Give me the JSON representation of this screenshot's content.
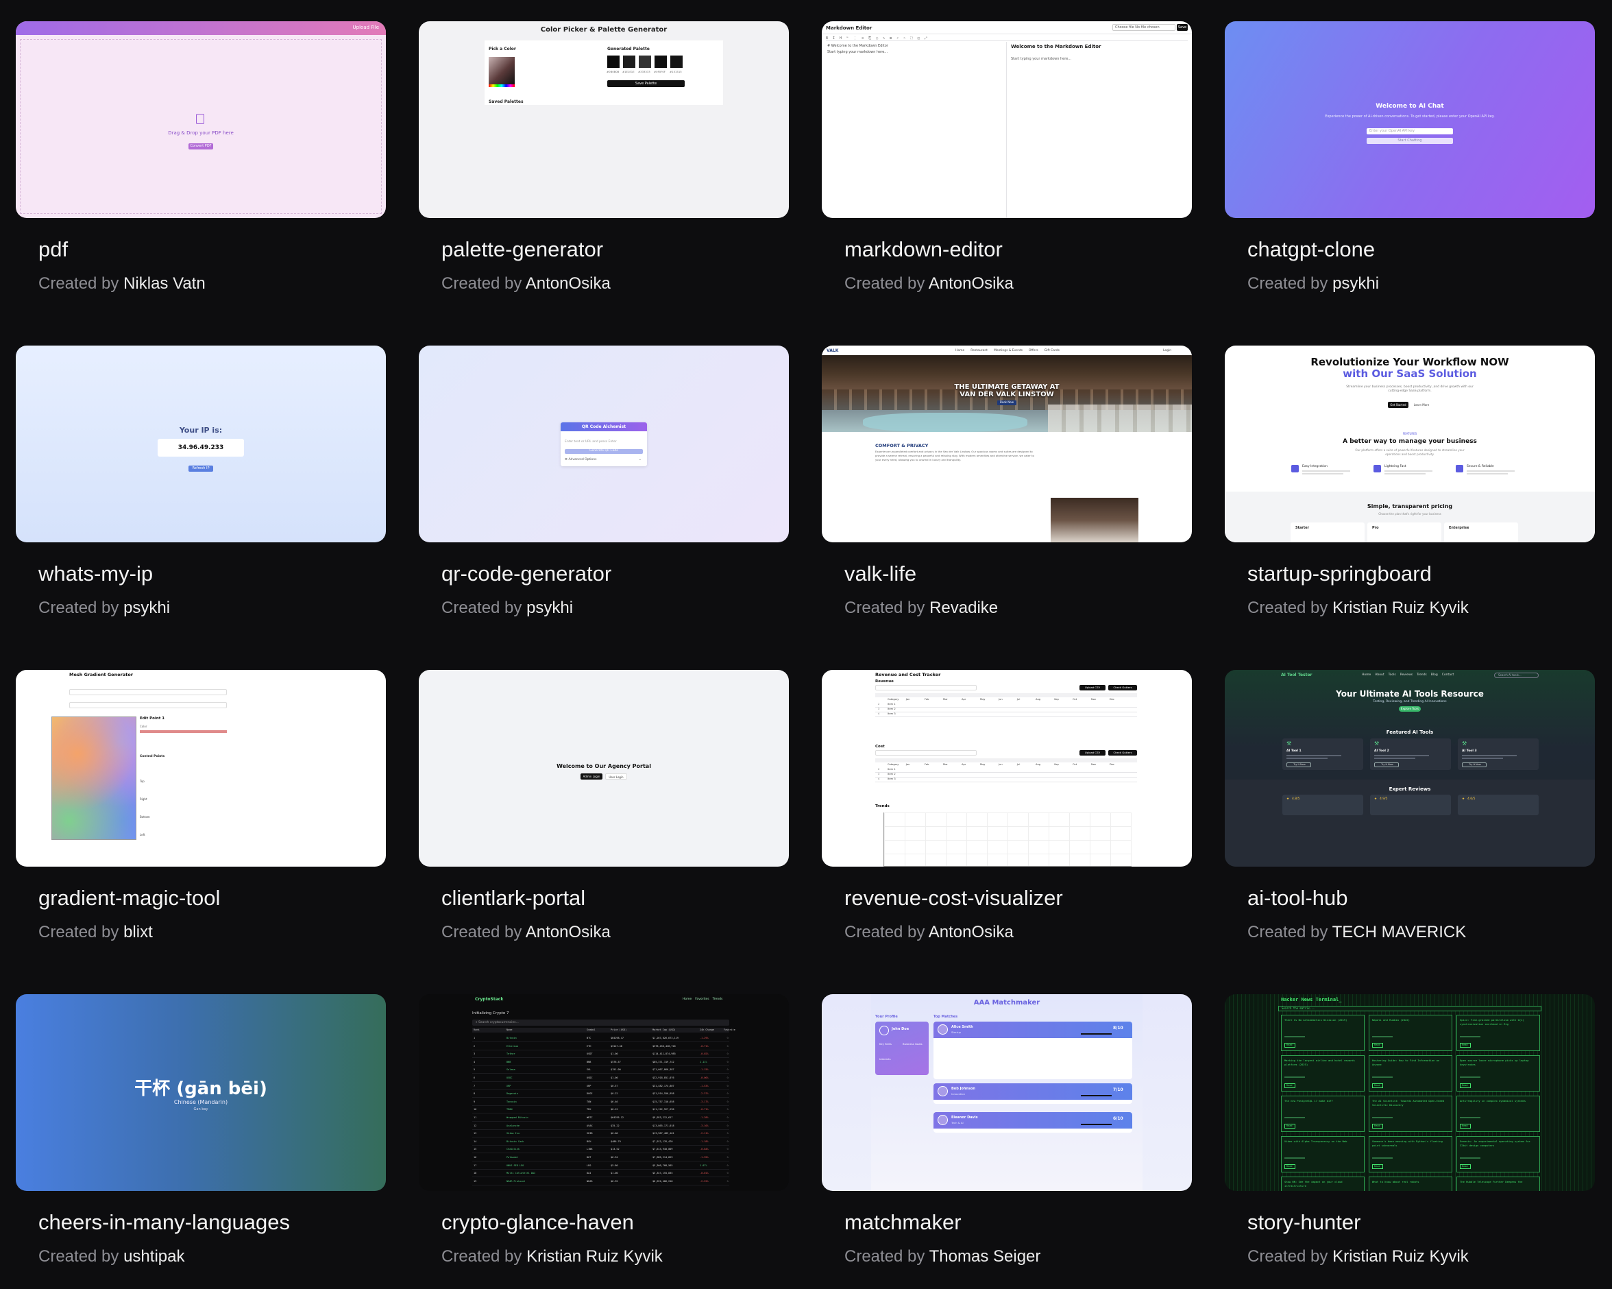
{
  "created_by_prefix": "Created by",
  "projects": [
    {
      "title": "pdf",
      "author": "Niklas Vatn",
      "thumb": {
        "header_button": "Upload File",
        "drop_text": "Drag & Drop your PDF here",
        "button": "Convert PDF"
      }
    },
    {
      "title": "palette-generator",
      "author": "AntonOsika",
      "thumb": {
        "heading": "Color Picker & Palette Generator",
        "pick_label": "Pick a Color",
        "generated_label": "Generated Palette",
        "saved_label": "Saved Palettes",
        "save_button": "Save Palette",
        "swatches": [
          "#0b0b0b",
          "#1e1e1e",
          "#333333",
          "#0f0f0f",
          "#151515"
        ],
        "swatch_codes": [
          "#0B0B0B",
          "#1E1E1E",
          "#333333",
          "#0F0F0F",
          "#151515"
        ]
      }
    },
    {
      "title": "markdown-editor",
      "author": "AntonOsika",
      "thumb": {
        "heading": "Markdown Editor",
        "file_placeholder": "Choose file  No file chosen",
        "file_button": "Save",
        "left_line1": "# Welcome to the Markdown Editor",
        "left_line2": "Start typing your markdown here...",
        "preview_title": "Welcome to the Markdown Editor",
        "preview_text": "Start typing your markdown here..."
      }
    },
    {
      "title": "chatgpt-clone",
      "author": "psykhi",
      "thumb": {
        "heading": "Welcome to AI Chat",
        "subtitle": "Experience the power of AI-driven conversations. To get started, please enter your OpenAI API key.",
        "input_placeholder": "Enter your OpenAI API key",
        "button": "Start Chatting"
      }
    },
    {
      "title": "whats-my-ip",
      "author": "psykhi",
      "thumb": {
        "label": "Your IP is:",
        "ip": "34.96.49.233",
        "button": "Refresh IP"
      }
    },
    {
      "title": "qr-code-generator",
      "author": "psykhi",
      "thumb": {
        "header": "QR Code Alchemist",
        "input_placeholder": "Enter text or URL and press Enter",
        "button": "Generate QR Code",
        "advanced": "Advanced Options"
      }
    },
    {
      "title": "valk-life",
      "author": "Revadike",
      "thumb": {
        "brand": "VALK",
        "nav": [
          "Home",
          "Restaurant",
          "Meetings & Events",
          "Offers",
          "Gift Cards"
        ],
        "login": "Login",
        "hero_line1": "THE ULTIMATE GETAWAY AT",
        "hero_line2": "VAN DER VALK LINSTOW",
        "hero_button": "Book Now",
        "section_title": "COMFORT & PRIVACY",
        "section_text": "Experience unparalleled comfort and privacy in the Van der Valk Linstow. Our spacious rooms and suites are designed to provide a serene retreat, ensuring a peaceful and relaxing stay. With modern amenities and attentive service, we cater to your every need, allowing you to unwind in luxury and tranquility."
      }
    },
    {
      "title": "startup-springboard",
      "author": "Kristian Ruiz Kyvik",
      "thumb": {
        "hero_line1": "Revolutionize Your Workflow NOW",
        "hero_line2": "with Our SaaS Solution",
        "hero_sub": "Streamline your business processes, boost productivity, and drive growth with our cutting-edge SaaS platform.",
        "btn_primary": "Get Started",
        "btn_secondary": "Learn More",
        "features_label": "FEATURES",
        "features_title": "A better way to manage your business",
        "features_sub": "Our platform offers a suite of powerful features designed to streamline your operations and boost productivity.",
        "features": [
          "Easy Integration",
          "Lightning Fast",
          "Secure & Reliable"
        ],
        "pricing_title": "Simple, transparent pricing",
        "pricing_sub": "Choose the plan that's right for your business",
        "plans": [
          "Starter",
          "Pro",
          "Enterprise"
        ]
      }
    },
    {
      "title": "gradient-magic-tool",
      "author": "blixt",
      "thumb": {
        "heading": "Mesh Gradient Generator",
        "edit_label": "Edit Point 1",
        "color_label": "Color",
        "control_label": "Control Points",
        "labels": [
          "Top",
          "Right",
          "Bottom",
          "Left"
        ]
      }
    },
    {
      "title": "clientlark-portal",
      "author": "AntonOsika",
      "thumb": {
        "heading": "Welcome to Our Agency Portal",
        "btn_admin": "Admin Login",
        "btn_user": "User Login"
      }
    },
    {
      "title": "revenue-cost-visualizer",
      "author": "AntonOsika",
      "thumb": {
        "heading": "Revenue and Cost Tracker",
        "revenue_label": "Revenue",
        "cost_label": "Cost",
        "trends_label": "Trends",
        "upload": "Upload CSV",
        "check": "Check Gutters",
        "months": [
          "Category",
          "Jan",
          "Feb",
          "Mar",
          "Apr",
          "May",
          "Jun",
          "Jul",
          "Aug",
          "Sep",
          "Oct",
          "Nov",
          "Dec"
        ],
        "items": [
          "Item 1",
          "Item 2",
          "Item 3"
        ]
      }
    },
    {
      "title": "ai-tool-hub",
      "author": "TECH MAVERICK",
      "thumb": {
        "brand": "AI Tool Tester",
        "nav": [
          "Home",
          "About",
          "Tools",
          "Reviews",
          "Trends",
          "Blog",
          "Contact"
        ],
        "search_placeholder": "Search AI tools...",
        "hero_title": "Your Ultimate AI Tools Resource",
        "hero_sub": "Testing, Reviewing, and Trending AI Innovations",
        "hero_button": "Explore Tools",
        "featured_title": "Featured AI Tools",
        "tools": [
          "AI Tool 1",
          "AI Tool 2",
          "AI Tool 3"
        ],
        "tool_button": "Try It Now",
        "reviews_title": "Expert Reviews",
        "ratings": [
          "4.8/5",
          "4.9/5",
          "4.6/5"
        ]
      }
    },
    {
      "title": "cheers-in-many-languages",
      "author": "ushtipak",
      "thumb": {
        "phrase": "干杯 (gān bēi)",
        "language": "Chinese (Mandarin)",
        "pronunciation": "Gan bay"
      }
    },
    {
      "title": "crypto-glance-haven",
      "author": "Kristian Ruiz Kyvik",
      "thumb": {
        "brand": "CryptoStack",
        "nav": [
          "Home",
          "Favorites",
          "Trends"
        ],
        "status": "Initializing Crypto 7",
        "search_placeholder": "Search cryptocurrencies...",
        "columns": [
          "Rank",
          "Name",
          "Symbol",
          "Price (USD)",
          "Market Cap (USD)",
          "24h Change",
          "Favorite"
        ],
        "rows": [
          [
            "1",
            "Bitcoin",
            "BTC",
            "$64298.47",
            "$1,267,826,673,119",
            "-1.29%"
          ],
          [
            "2",
            "Ethereum",
            "ETH",
            "$3147.48",
            "$378,456,428,726",
            "-0.71%"
          ],
          [
            "3",
            "Tether",
            "USDT",
            "$1.00",
            "$114,411,874,985",
            "-0.02%"
          ],
          [
            "4",
            "BNB",
            "BNB",
            "$578.57",
            "$85,371,319,742",
            "1.11%"
          ],
          [
            "5",
            "Solana",
            "SOL",
            "$151.00",
            "$71,667,860,387",
            "-1.15%"
          ],
          [
            "6",
            "USDC",
            "USDC",
            "$1.00",
            "$32,918,851,076",
            "-0.00%"
          ],
          [
            "7",
            "XRP",
            "XRP",
            "$0.57",
            "$31,482,174,807",
            "-1.53%"
          ],
          [
            "8",
            "Dogecoin",
            "DOGE",
            "$0.22",
            "$31,914,550,958",
            "-2.37%"
          ],
          [
            "9",
            "Toncoin",
            "TON",
            "$6.46",
            "$15,757,310,658",
            "-3.17%"
          ],
          [
            "10",
            "TRON",
            "TRX",
            "$0.12",
            "$11,122,927,290",
            "-0.71%"
          ],
          [
            "11",
            "Wrapped Bitcoin",
            "WBTC",
            "$64295.12",
            "$9,953,212,617",
            "-1.28%"
          ],
          [
            "12",
            "Avalanche",
            "AVAX",
            "$35.22",
            "$13,865,171,018",
            "-3.10%"
          ],
          [
            "13",
            "Shiba Inu",
            "SHIB",
            "$0.00",
            "$13,967,485,101",
            "-2.11%"
          ],
          [
            "14",
            "Bitcoin Cash",
            "BCH",
            "$486.79",
            "$7,912,176,470",
            "-1.18%"
          ],
          [
            "15",
            "Chainlink",
            "LINK",
            "$13.52",
            "$7,613,940,009",
            "-0.84%"
          ],
          [
            "16",
            "Polkadot",
            "DOT",
            "$6.94",
            "$7,985,214,829",
            "-1.35%"
          ],
          [
            "17",
            "UNUS SED LEO",
            "LEO",
            "$5.80",
            "$5,366,708,565",
            "1.07%"
          ],
          [
            "18",
            "Multi Collateral DAI",
            "DAI",
            "$1.00",
            "$5,347,155,835",
            "-0.01%"
          ],
          [
            "19",
            "NEAR Protocol",
            "NEAR",
            "$6.35",
            "$6,922,486,218",
            "-2.22%"
          ]
        ]
      }
    },
    {
      "title": "matchmaker",
      "author": "Thomas Seiger",
      "thumb": {
        "heading": "AAA Matchmaker",
        "profile_label": "Your Profile",
        "matches_label": "Top Matches",
        "profile_name": "John Doe",
        "key_skills": "Key Skills",
        "business_goals": "Business Goals",
        "interests": "Interests",
        "matches": [
          {
            "name": "Alice Smith",
            "role": "Startup",
            "score": "8/10"
          },
          {
            "name": "Bob Johnson",
            "role": "Innovation",
            "score": "7/10"
          },
          {
            "name": "Eleanor Davis",
            "role": "Tech & AI",
            "score": "6/10"
          }
        ]
      }
    },
    {
      "title": "story-hunter",
      "author": "Kristian Ruiz Kyvik",
      "thumb": {
        "heading": "Hacker News Terminal_",
        "search_placeholder": "Search the matrix...",
        "read": "Read",
        "stories": [
          "There Is No Antimemetics Division (2019)",
          "Napoli and Rumbia (2022)",
          "Spice: Fine-grained parallelism with O(n) synchronization overhead in Zig",
          "Marking the largest airline and hotel rewards platform (2025)",
          "Hostering Guide: How to Find Information on Anyone",
          "Open source laser microphone picks up laptop keystrokes",
          "The new PostgreSQL 17 make diff",
          "The AI Scientist: Towards Automated Open-Ended Scientific Discovery",
          "Antifragility in complex dynamical systems",
          "Video with Alpha Transparency on the Web",
          "Someone's been messing with Python's floating point subnormals",
          "Genesis: An experimental operating system for 32bit design computers",
          "Show HN: See the impact on your cloud infrastructure",
          "What to know about real robots",
          "The Hubble Telescope Further Deepens the"
        ]
      }
    }
  ]
}
